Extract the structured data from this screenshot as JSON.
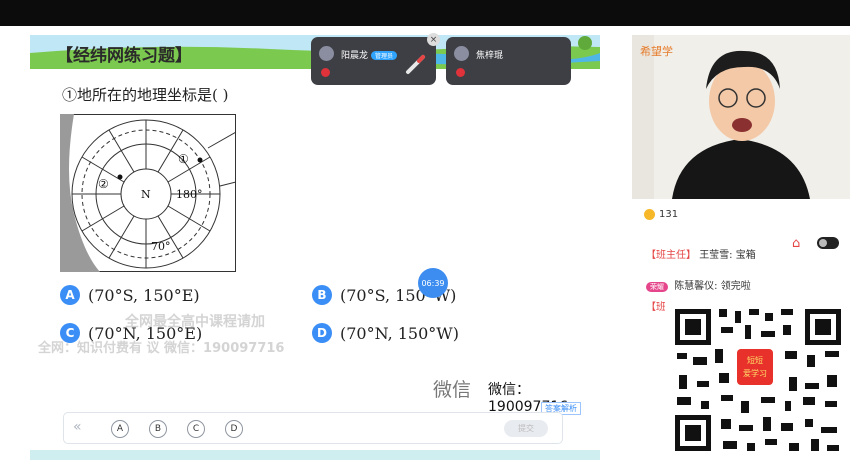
{
  "banner": {
    "title": "【经纬网练习题】"
  },
  "question": {
    "text": "①地所在的地理坐标是(      )"
  },
  "diagram": {
    "north": "N",
    "point1": "①",
    "point2": "②",
    "lon_label": "180°",
    "lat_label": "70°"
  },
  "options": [
    {
      "letter": "A",
      "text": "(70°S, 150°E)"
    },
    {
      "letter": "B",
      "text": "(70°S, 150°W)"
    },
    {
      "letter": "C",
      "text": "(70°N, 150°E)"
    },
    {
      "letter": "D",
      "text": "(70°N, 150°W)"
    }
  ],
  "timer": "06:39",
  "participants": [
    {
      "name": "阳晨龙",
      "tag": "管理员"
    },
    {
      "name": "焦梓琨"
    }
  ],
  "watermarks": {
    "line1": "全网最全高中课程请加",
    "line2": "全网：知识付费有 议 微信：190097716"
  },
  "wechat": {
    "big": "微信",
    "id": "微信：190097716"
  },
  "analysis_label": "答案解析",
  "answer_bar": {
    "collapse_icon": "«",
    "choices": [
      "A",
      "B",
      "C",
      "D"
    ],
    "submit": "提交"
  },
  "teacher": {
    "logo": "希望学"
  },
  "coins": "131",
  "chat": [
    {
      "role": "【班主任】",
      "text": "王莹雪: 宝箱"
    },
    {
      "badge": "荣耀",
      "text": "陈慧馨仪: 领完啦"
    },
    {
      "role": "【班"
    }
  ],
  "qr": {
    "logo_text": "短短\n爱学习"
  },
  "colors": {
    "accent": "#3a8ef6",
    "banner_green": "#7cc94f",
    "bottom_strip": "#cfeef0"
  }
}
